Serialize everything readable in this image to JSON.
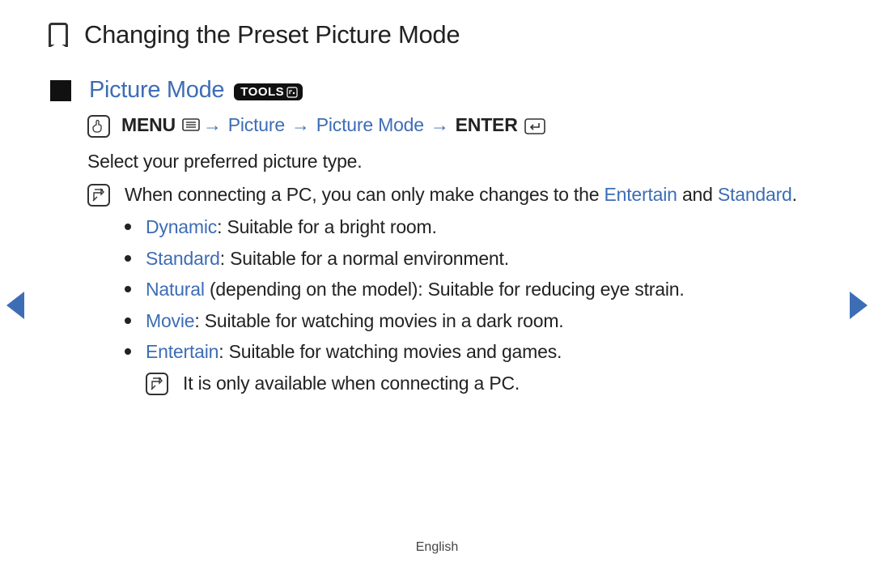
{
  "title": "Changing the Preset Picture Mode",
  "section": {
    "heading": "Picture Mode",
    "tools_label": "TOOLS"
  },
  "nav_path": {
    "menu": "MENU",
    "arrow": "→",
    "p1": "Picture",
    "p2": "Picture Mode",
    "enter": "ENTER"
  },
  "intro": "Select your preferred picture type.",
  "pc_note": {
    "pre": "When connecting a PC, you can only make changes to the ",
    "link1": "Entertain",
    "mid": " and ",
    "link2": "Standard",
    "post": "."
  },
  "modes": [
    {
      "name": "Dynamic",
      "desc": ": Suitable for a bright room."
    },
    {
      "name": "Standard",
      "desc": ": Suitable for a normal environment."
    },
    {
      "name": "Natural",
      "paren": " (depending on the model)",
      "desc": ": Suitable for reducing eye strain."
    },
    {
      "name": "Movie",
      "desc": ": Suitable for watching movies in a dark room."
    },
    {
      "name": "Entertain",
      "desc": ": Suitable for watching movies and games."
    }
  ],
  "entertain_note": "It is only available when connecting a PC.",
  "footer_lang": "English"
}
